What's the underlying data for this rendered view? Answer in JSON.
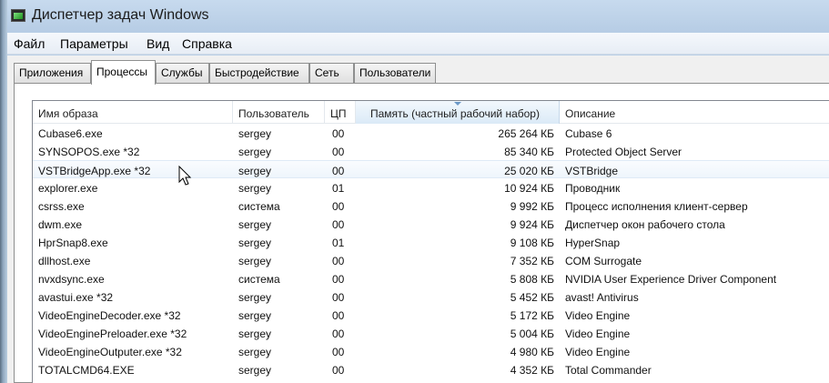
{
  "window": {
    "title": "Диспетчер задач Windows",
    "icon": "task-manager-icon"
  },
  "menu": [
    "Файл",
    "Параметры",
    "Вид",
    "Справка"
  ],
  "tabs": [
    {
      "label": "Приложения",
      "active": false
    },
    {
      "label": "Процессы",
      "active": true
    },
    {
      "label": "Службы",
      "active": false
    },
    {
      "label": "Быстродействие",
      "active": false
    },
    {
      "label": "Сеть",
      "active": false
    },
    {
      "label": "Пользователи",
      "active": false
    }
  ],
  "columns": {
    "image": "Имя образа",
    "user": "Пользователь",
    "cpu": "ЦП",
    "memory": "Память (частный рабочий набор)",
    "description": "Описание"
  },
  "processes": [
    {
      "image": "Cubase6.exe",
      "user": "sergey",
      "cpu": "00",
      "memory": "265 264 КБ",
      "description": "Cubase 6"
    },
    {
      "image": "SYNSOPOS.exe *32",
      "user": "sergey",
      "cpu": "00",
      "memory": "85 340 КБ",
      "description": "Protected Object Server"
    },
    {
      "image": "VSTBridgeApp.exe *32",
      "user": "sergey",
      "cpu": "00",
      "memory": "25 020 КБ",
      "description": "VSTBridge"
    },
    {
      "image": "explorer.exe",
      "user": "sergey",
      "cpu": "01",
      "memory": "10 924 КБ",
      "description": "Проводник"
    },
    {
      "image": "csrss.exe",
      "user": "система",
      "cpu": "00",
      "memory": "9 992 КБ",
      "description": "Процесс исполнения клиент-сервер"
    },
    {
      "image": "dwm.exe",
      "user": "sergey",
      "cpu": "00",
      "memory": "9 924 КБ",
      "description": "Диспетчер окон рабочего стола"
    },
    {
      "image": "HprSnap8.exe",
      "user": "sergey",
      "cpu": "01",
      "memory": "9 108 КБ",
      "description": "HyperSnap"
    },
    {
      "image": "dllhost.exe",
      "user": "sergey",
      "cpu": "00",
      "memory": "7 352 КБ",
      "description": "COM Surrogate"
    },
    {
      "image": "nvxdsync.exe",
      "user": "система",
      "cpu": "00",
      "memory": "5 808 КБ",
      "description": "NVIDIA User Experience Driver Component"
    },
    {
      "image": "avastui.exe *32",
      "user": "sergey",
      "cpu": "00",
      "memory": "5 452 КБ",
      "description": "avast! Antivirus"
    },
    {
      "image": "VideoEngineDecoder.exe *32",
      "user": "sergey",
      "cpu": "00",
      "memory": "5 172 КБ",
      "description": "Video Engine"
    },
    {
      "image": "VideoEnginePreloader.exe *32",
      "user": "sergey",
      "cpu": "00",
      "memory": "5 004 КБ",
      "description": "Video Engine"
    },
    {
      "image": "VideoEngineOutputer.exe *32",
      "user": "sergey",
      "cpu": "00",
      "memory": "4 980 КБ",
      "description": "Video Engine"
    },
    {
      "image": "TOTALCMD64.EXE",
      "user": "sergey",
      "cpu": "00",
      "memory": "4 352 КБ",
      "description": "Total Commander"
    }
  ],
  "hovered_row": 2,
  "sorted_column": "memory",
  "colors": {
    "hover_row": "#eef5fc",
    "sorted_header": "#dbeaf7",
    "window_frame": "#b7cde5"
  }
}
